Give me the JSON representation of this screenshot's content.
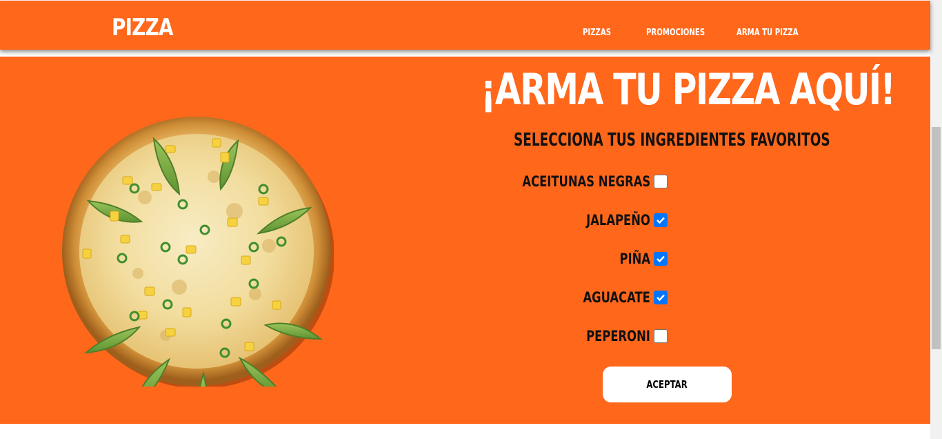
{
  "navbar": {
    "brand": "PIZZA",
    "links": [
      "PIZZAS",
      "PROMOCIONES",
      "ARMA TU PIZZA"
    ]
  },
  "hero": {
    "title": "¡ARMA TU PIZZA AQUÍ!",
    "subtitle": "SELECCIONA TUS INGREDIENTES FAVORITOS",
    "ingredients": [
      {
        "label": "ACEITUNAS NEGRAS",
        "checked": false
      },
      {
        "label": "JALAPEÑO",
        "checked": true
      },
      {
        "label": "PIÑA",
        "checked": true
      },
      {
        "label": "AGUACATE",
        "checked": true
      },
      {
        "label": "PEPERONI",
        "checked": false
      }
    ],
    "accept_label": "ACEPTAR"
  },
  "colors": {
    "brand_orange": "#ff671b",
    "checkbox_blue": "#0075ff",
    "text_dark": "#111111"
  }
}
